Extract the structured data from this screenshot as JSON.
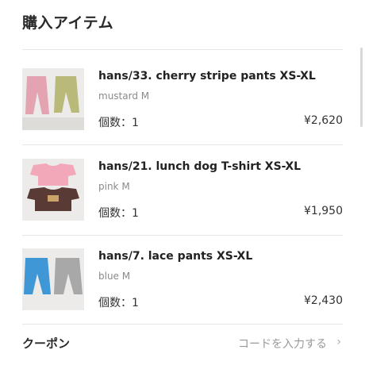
{
  "section": {
    "title": "購入アイテム"
  },
  "items": [
    {
      "name": "hans/33. cherry stripe pants XS-XL",
      "variant": "mustard M",
      "qty": "個数：1",
      "price": "¥2,620",
      "thumb_icon": "pants-photo"
    },
    {
      "name": "hans/21. lunch dog T-shirt XS-XL",
      "variant": "pink M",
      "qty": "個数：1",
      "price": "¥1,950",
      "thumb_icon": "tshirt-photo"
    },
    {
      "name": "hans/7. lace pants XS-XL",
      "variant": "blue M",
      "qty": "個数：1",
      "price": "¥2,430",
      "thumb_icon": "pants-photo"
    }
  ],
  "coupon": {
    "label": "クーポン",
    "action": "コードを入力する",
    "chevron_icon": "chevron-right-icon"
  }
}
